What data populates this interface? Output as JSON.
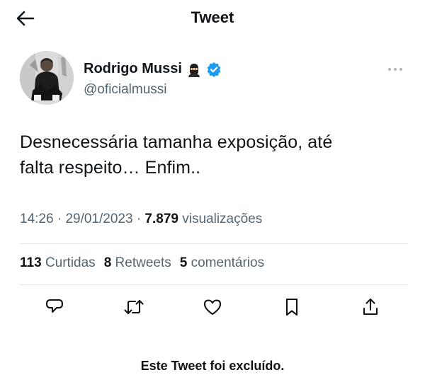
{
  "header": {
    "title": "Tweet",
    "back_icon": "arrow-left-icon"
  },
  "author": {
    "display_name": "Rodrigo Mussi",
    "name_emoji": "ninja-emoji-icon",
    "verified_icon": "verified-badge-icon",
    "verified_color": "#1d9bf0",
    "handle": "@oficialmussi",
    "more_icon": "more-horizontal-icon"
  },
  "tweet": {
    "text_line1": "Desnecessária tamanha exposição, até",
    "text_line2": "falta respeito… Enfim..",
    "time": "14:26",
    "date": "29/01/2023",
    "views_count": "7.879",
    "views_label": "visualizações",
    "separator": "·"
  },
  "stats": {
    "likes_count": "113",
    "likes_label": "Curtidas",
    "retweets_count": "8",
    "retweets_label": "Retweets",
    "comments_count": "5",
    "comments_label": "comentários"
  },
  "actions": [
    {
      "name": "reply",
      "icon": "comment-icon"
    },
    {
      "name": "retweet",
      "icon": "retweet-icon"
    },
    {
      "name": "like",
      "icon": "heart-icon"
    },
    {
      "name": "bookmark",
      "icon": "bookmark-icon"
    },
    {
      "name": "share",
      "icon": "share-icon"
    }
  ],
  "notice": {
    "deleted_text": "Este Tweet foi excluído."
  },
  "colors": {
    "text_primary": "#0f1419",
    "text_secondary": "#536471",
    "divider": "#e3e6e8"
  }
}
